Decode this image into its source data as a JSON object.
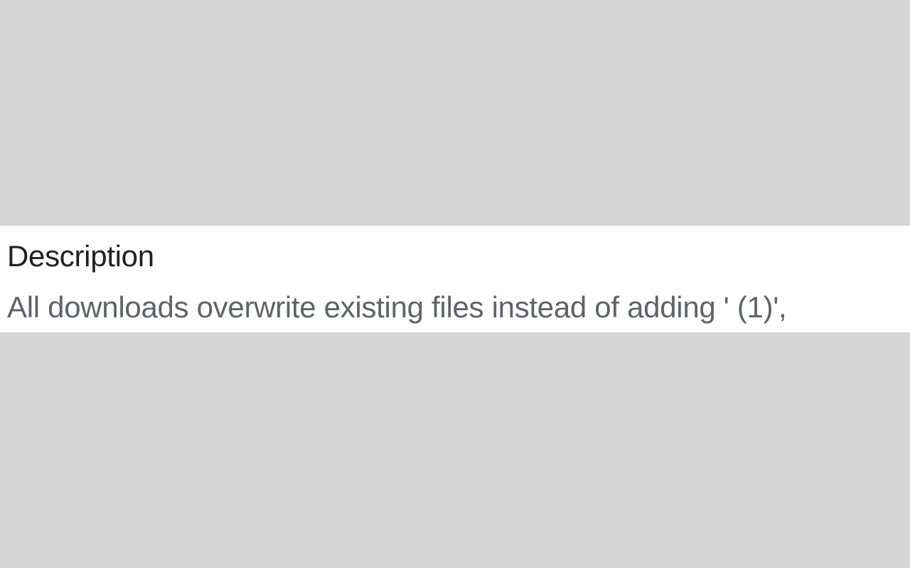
{
  "panel": {
    "heading": "Description",
    "body": "All downloads overwrite existing files instead of adding ' (1)',"
  }
}
